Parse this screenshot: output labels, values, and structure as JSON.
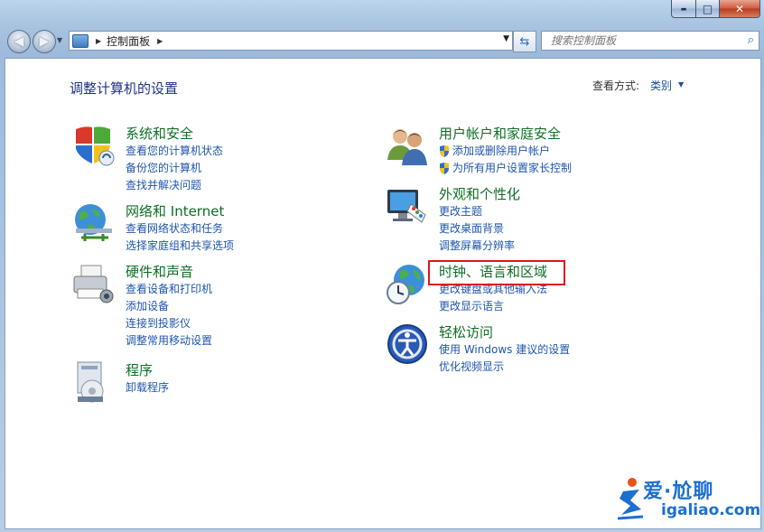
{
  "window": {
    "buttons": {
      "minimize": "▬",
      "maximize": "□",
      "close": "✕"
    }
  },
  "toolbar": {
    "back_icon": "back-arrow-icon",
    "forward_icon": "forward-arrow-icon",
    "breadcrumb": [
      "控制面板"
    ],
    "search_placeholder": "搜索控制面板"
  },
  "main": {
    "heading": "调整计算机的设置",
    "view_by_label": "查看方式:",
    "view_by_value": "类别",
    "left_column": [
      {
        "icon": "security-shield-icon",
        "title": "系统和安全",
        "links": [
          "查看您的计算机状态",
          "备份您的计算机",
          "查找并解决问题"
        ]
      },
      {
        "icon": "network-globe-icon",
        "title": "网络和 Internet",
        "links": [
          "查看网络状态和任务",
          "选择家庭组和共享选项"
        ]
      },
      {
        "icon": "printer-icon",
        "title": "硬件和声音",
        "links": [
          "查看设备和打印机",
          "添加设备",
          "连接到投影仪",
          "调整常用移动设置"
        ]
      },
      {
        "icon": "programs-disc-icon",
        "title": "程序",
        "links": [
          "卸载程序"
        ]
      }
    ],
    "right_column": [
      {
        "icon": "users-icon",
        "title": "用户帐户和家庭安全",
        "links": [
          "添加或删除用户帐户",
          "为所有用户设置家长控制"
        ]
      },
      {
        "icon": "monitor-palette-icon",
        "title": "外观和个性化",
        "links": [
          "更改主题",
          "更改桌面背景",
          "调整屏幕分辨率"
        ]
      },
      {
        "icon": "clock-globe-icon",
        "title": "时钟、语言和区域",
        "links": [
          "更改键盘或其他输入法",
          "更改显示语言"
        ]
      },
      {
        "icon": "ease-of-access-icon",
        "title": "轻松访问",
        "links": [
          "使用 Windows 建议的设置",
          "优化视频显示"
        ]
      }
    ]
  },
  "watermark": {
    "title": "爱·尬聊",
    "url": "igaliao.com"
  },
  "colors": {
    "title_green": "#0e6f25",
    "link_blue": "#1f55ae",
    "heading_blue": "#1e3287",
    "highlight_red": "#e2141b"
  }
}
